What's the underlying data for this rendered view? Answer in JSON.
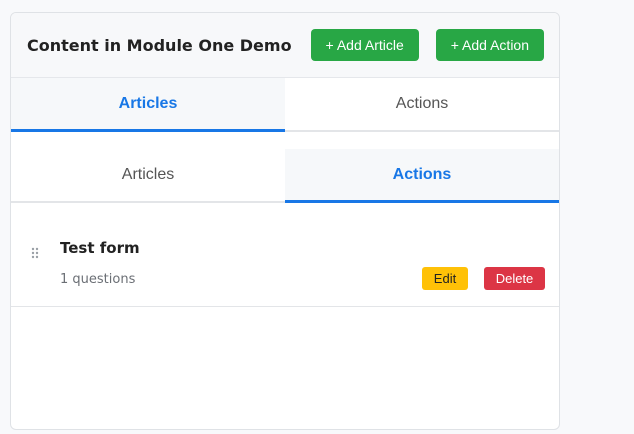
{
  "header": {
    "title": "Content in Module One Demo",
    "add_article_label": "+ Add Article",
    "add_action_label": "+ Add Action"
  },
  "tabs": [
    {
      "label": "Articles",
      "active": true
    },
    {
      "label": "Actions",
      "active": false
    }
  ],
  "subtabs": [
    {
      "label": "Articles",
      "active": false
    },
    {
      "label": "Actions",
      "active": true
    }
  ],
  "items": [
    {
      "title": "Test form",
      "subtitle": "1 questions",
      "edit_label": "Edit",
      "delete_label": "Delete",
      "grip_icon": "drag-handle-icon"
    }
  ],
  "colors": {
    "accent": "#1877e6",
    "success": "#28a745",
    "warning": "#ffc107",
    "danger": "#dc3545"
  }
}
